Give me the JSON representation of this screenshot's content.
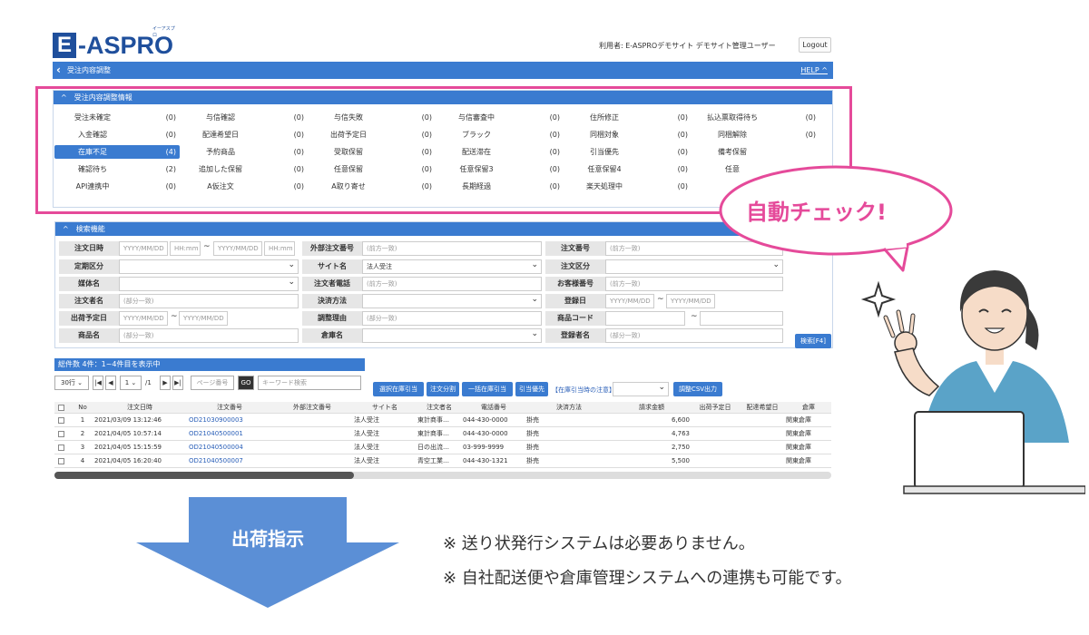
{
  "logo": {
    "main": "-ASPRO",
    "e": "E",
    "ruby": "イーアスプロ"
  },
  "header": {
    "user_line": "利用者: E-ASPROデモサイト デモサイト管理ユーザー",
    "logout": "Logout"
  },
  "titlebar": {
    "back": "‹",
    "title": "受注内容調整",
    "help": "HELP ^"
  },
  "status_panel": {
    "title": "受注内容調整情報",
    "caret": "^",
    "items": [
      {
        "label": "受注未確定",
        "count": "(0)"
      },
      {
        "label": "与信確認",
        "count": "(0)"
      },
      {
        "label": "与信失敗",
        "count": "(0)"
      },
      {
        "label": "与信審査中",
        "count": "(0)"
      },
      {
        "label": "住所修正",
        "count": "(0)"
      },
      {
        "label": "払込票取得待ち",
        "count": "(0)"
      },
      {
        "label": "入金確認",
        "count": "(0)"
      },
      {
        "label": "配達希望日",
        "count": "(0)"
      },
      {
        "label": "出荷予定日",
        "count": "(0)"
      },
      {
        "label": "ブラック",
        "count": "(0)"
      },
      {
        "label": "同梱対象",
        "count": "(0)"
      },
      {
        "label": "同梱解除",
        "count": "(0)"
      },
      {
        "label": "在庫不足",
        "count": "(4)",
        "active": true
      },
      {
        "label": "予約商品",
        "count": "(0)"
      },
      {
        "label": "受取保留",
        "count": "(0)"
      },
      {
        "label": "配送滞在",
        "count": "(0)"
      },
      {
        "label": "引当優先",
        "count": "(0)"
      },
      {
        "label": "備考保留",
        "count": ""
      },
      {
        "label": "確認待ち",
        "count": "(2)"
      },
      {
        "label": "追加した保留",
        "count": "(0)"
      },
      {
        "label": "任意保留",
        "count": "(0)"
      },
      {
        "label": "任意保留3",
        "count": "(0)"
      },
      {
        "label": "任意保留4",
        "count": "(0)"
      },
      {
        "label": "任意",
        "count": ""
      },
      {
        "label": "API連携中",
        "count": "(0)"
      },
      {
        "label": "A仮注文",
        "count": "(0)"
      },
      {
        "label": "A取り寄せ",
        "count": "(0)"
      },
      {
        "label": "長期経過",
        "count": "(0)"
      },
      {
        "label": "楽天処理中",
        "count": "(0)"
      },
      {
        "label": "",
        "count": ""
      }
    ]
  },
  "bubble": {
    "text": "自動チェック!"
  },
  "search_panel": {
    "title": "検索機能",
    "labels": {
      "order_date": "注文日時",
      "ext_order_no": "外部注文番号",
      "order_no": "注文番号",
      "periodic": "定期区分",
      "site": "サイト名",
      "order_type": "注文区分",
      "media": "媒体名",
      "tel": "注文者電話",
      "customer_no": "お客様番号",
      "orderer": "注文者名",
      "payment": "決済方法",
      "reg_date": "登録日",
      "ship_date": "出荷予定日",
      "adjust_reason": "調整理由",
      "product_code": "商品コード",
      "product_name": "商品名",
      "warehouse": "倉庫名",
      "registrant": "登録者名"
    },
    "values": {
      "date_ph": "YYYY/MM/DD",
      "time_ph": "HH:mm",
      "tilde": "~",
      "prefix_match": "(前方一致)",
      "partial_match": "(部分一致)",
      "site_value": "法人受注"
    },
    "search_button": "検索[F4]"
  },
  "list": {
    "count_text": "総件数 4件：1~4件目を表示中",
    "per_page": "30行 ⌄",
    "page": "1 ⌄",
    "page_total": "/1",
    "page_no_ph": "ページ番号",
    "go": "GO",
    "keyword_ph": "キーワード検索",
    "actions": [
      "選択在庫引当",
      "注文分割",
      "一括在庫引当",
      "引当優先"
    ],
    "notice": "【在庫引当時の注意】",
    "csv": "調整CSV出力",
    "columns": [
      "No",
      "注文日時",
      "注文番号",
      "外部注文番号",
      "サイト名",
      "注文者名",
      "電話番号",
      "決済方法",
      "請求金額",
      "出荷予定日",
      "配達希望日",
      "倉庫"
    ],
    "rows": [
      {
        "no": "1",
        "date": "2021/03/09 13:12:46",
        "order": "OD21030900003",
        "site": "法人受注",
        "name": "東計商事…",
        "tel": "044-430-0000",
        "pay": "掛売",
        "amount": "6,600",
        "wh": "関東倉庫"
      },
      {
        "no": "2",
        "date": "2021/04/05 10:57:14",
        "order": "OD21040500001",
        "site": "法人受注",
        "name": "東計商事…",
        "tel": "044-430-0000",
        "pay": "掛売",
        "amount": "4,763",
        "wh": "関東倉庫"
      },
      {
        "no": "3",
        "date": "2021/04/05 15:15:59",
        "order": "OD21040500004",
        "site": "法人受注",
        "name": "日の出流…",
        "tel": "03-999-9999",
        "pay": "掛売",
        "amount": "2,750",
        "wh": "関東倉庫"
      },
      {
        "no": "4",
        "date": "2021/04/05 16:20:40",
        "order": "OD21040500007",
        "site": "法人受注",
        "name": "青空工業…",
        "tel": "044-430-1321",
        "pay": "掛売",
        "amount": "5,500",
        "wh": "関東倉庫"
      }
    ]
  },
  "arrow": {
    "label": "出荷指示"
  },
  "notes": [
    "※ 送り状発行システムは必要ありません。",
    "※ 自社配送便や倉庫管理システムへの連携も可能です。"
  ],
  "colors": {
    "brand": "#1f4f9c",
    "accent": "#3a7bd0",
    "highlight": "#e54a9a",
    "arrow": "#5b8fd6"
  }
}
